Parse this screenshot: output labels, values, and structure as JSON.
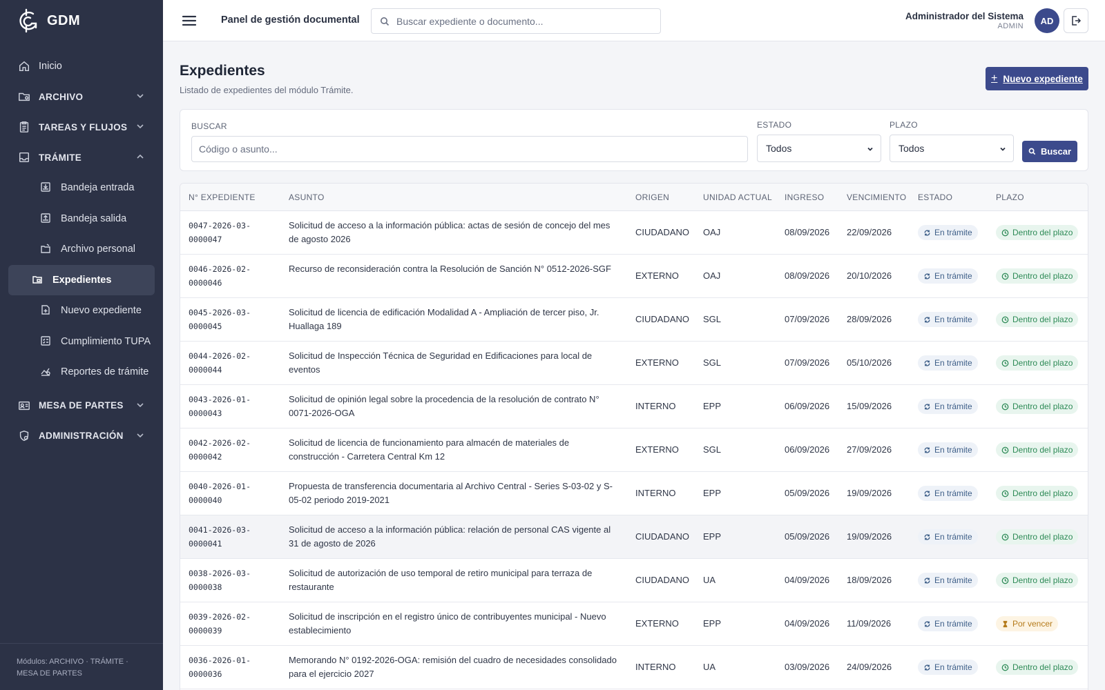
{
  "brand": {
    "name": "GDM"
  },
  "sidebar": {
    "items": [
      {
        "label": "Inicio",
        "icon": "home-icon",
        "type": "item"
      },
      {
        "label": "ARCHIVO",
        "icon": "folder-icon",
        "type": "section",
        "expanded": false
      },
      {
        "label": "TAREAS Y FLUJOS",
        "icon": "clipboard-icon",
        "type": "section",
        "expanded": false
      },
      {
        "label": "TRÁMITE",
        "icon": "inbox-icon",
        "type": "section",
        "expanded": true
      }
    ],
    "sub_items": [
      {
        "label": "Bandeja entrada",
        "icon": "inbox-in-icon"
      },
      {
        "label": "Bandeja salida",
        "icon": "inbox-out-icon"
      },
      {
        "label": "Archivo personal",
        "icon": "archive-icon"
      },
      {
        "label": "Expedientes",
        "icon": "folder-open-icon",
        "active": true
      },
      {
        "label": "Nuevo expediente",
        "icon": "file-plus-icon"
      },
      {
        "label": "Cumplimiento TUPA",
        "icon": "checklist-icon"
      },
      {
        "label": "Reportes de trámite",
        "icon": "chart-icon"
      }
    ],
    "bottom_sections": [
      {
        "label": "MESA DE PARTES",
        "icon": "id-card-icon"
      },
      {
        "label": "ADMINISTRACIÓN",
        "icon": "shield-gear-icon"
      }
    ],
    "footer": "Módulos: ARCHIVO · TRÁMITE · MESA DE PARTES"
  },
  "topbar": {
    "title": "Panel de gestión documental",
    "search_placeholder": "Buscar expediente o documento...",
    "user_name": "Administrador del Sistema",
    "user_role": "ADMIN",
    "avatar_initials": "AD"
  },
  "page": {
    "title": "Expedientes",
    "subtitle": "Listado de expedientes del módulo Trámite.",
    "new_button": "Nuevo expediente"
  },
  "filters": {
    "search_label": "BUSCAR",
    "search_placeholder": "Código o asunto...",
    "estado_label": "ESTADO",
    "estado_value": "Todos",
    "plazo_label": "PLAZO",
    "plazo_value": "Todos",
    "button": "Buscar"
  },
  "table": {
    "columns": [
      "N° EXPEDIENTE",
      "ASUNTO",
      "ORIGEN",
      "UNIDAD ACTUAL",
      "INGRESO",
      "VENCIMIENTO",
      "ESTADO",
      "PLAZO"
    ],
    "rows": [
      {
        "code": "0047-2026-03-0000047",
        "subject": "Solicitud de acceso a la información pública: actas de sesión de concejo del mes de agosto 2026",
        "origin": "CIUDADANO",
        "unit": "OAJ",
        "in": "08/09/2026",
        "due": "22/09/2026",
        "status": "En trámite",
        "term": "Dentro del plazo",
        "term_type": "ok"
      },
      {
        "code": "0046-2026-02-0000046",
        "subject": "Recurso de reconsideración contra la Resolución de Sanción N° 0512-2026-SGF",
        "origin": "EXTERNO",
        "unit": "OAJ",
        "in": "08/09/2026",
        "due": "20/10/2026",
        "status": "En trámite",
        "term": "Dentro del plazo",
        "term_type": "ok"
      },
      {
        "code": "0045-2026-03-0000045",
        "subject": "Solicitud de licencia de edificación Modalidad A - Ampliación de tercer piso, Jr. Huallaga 189",
        "origin": "CIUDADANO",
        "unit": "SGL",
        "in": "07/09/2026",
        "due": "28/09/2026",
        "status": "En trámite",
        "term": "Dentro del plazo",
        "term_type": "ok"
      },
      {
        "code": "0044-2026-02-0000044",
        "subject": "Solicitud de Inspección Técnica de Seguridad en Edificaciones para local de eventos",
        "origin": "EXTERNO",
        "unit": "SGL",
        "in": "07/09/2026",
        "due": "05/10/2026",
        "status": "En trámite",
        "term": "Dentro del plazo",
        "term_type": "ok"
      },
      {
        "code": "0043-2026-01-0000043",
        "subject": "Solicitud de opinión legal sobre la procedencia de la resolución de contrato N° 0071-2026-OGA",
        "origin": "INTERNO",
        "unit": "EPP",
        "in": "06/09/2026",
        "due": "15/09/2026",
        "status": "En trámite",
        "term": "Dentro del plazo",
        "term_type": "ok"
      },
      {
        "code": "0042-2026-02-0000042",
        "subject": "Solicitud de licencia de funcionamiento para almacén de materiales de construcción - Carretera Central Km 12",
        "origin": "EXTERNO",
        "unit": "SGL",
        "in": "06/09/2026",
        "due": "27/09/2026",
        "status": "En trámite",
        "term": "Dentro del plazo",
        "term_type": "ok"
      },
      {
        "code": "0040-2026-01-0000040",
        "subject": "Propuesta de transferencia documentaria al Archivo Central - Series S-03-02 y S-05-02 periodo 2019-2021",
        "origin": "INTERNO",
        "unit": "EPP",
        "in": "05/09/2026",
        "due": "19/09/2026",
        "status": "En trámite",
        "term": "Dentro del plazo",
        "term_type": "ok"
      },
      {
        "code": "0041-2026-03-0000041",
        "subject": "Solicitud de acceso a la información pública: relación de personal CAS vigente al 31 de agosto de 2026",
        "origin": "CIUDADANO",
        "unit": "EPP",
        "in": "05/09/2026",
        "due": "19/09/2026",
        "status": "En trámite",
        "term": "Dentro del plazo",
        "term_type": "ok",
        "hover": true
      },
      {
        "code": "0038-2026-03-0000038",
        "subject": "Solicitud de autorización de uso temporal de retiro municipal para terraza de restaurante",
        "origin": "CIUDADANO",
        "unit": "UA",
        "in": "04/09/2026",
        "due": "18/09/2026",
        "status": "En trámite",
        "term": "Dentro del plazo",
        "term_type": "ok"
      },
      {
        "code": "0039-2026-02-0000039",
        "subject": "Solicitud de inscripción en el registro único de contribuyentes municipal - Nuevo establecimiento",
        "origin": "EXTERNO",
        "unit": "EPP",
        "in": "04/09/2026",
        "due": "11/09/2026",
        "status": "En trámite",
        "term": "Por vencer",
        "term_type": "warn"
      },
      {
        "code": "0036-2026-01-0000036",
        "subject": "Memorando N° 0192-2026-OGA: remisión del cuadro de necesidades consolidado para el ejercicio 2027",
        "origin": "INTERNO",
        "unit": "UA",
        "in": "03/09/2026",
        "due": "24/09/2026",
        "status": "En trámite",
        "term": "Dentro del plazo",
        "term_type": "ok"
      }
    ]
  },
  "colors": {
    "sidebar": "#2c3246",
    "accent": "#3c4a8c",
    "ok": "#2d8a56",
    "warn": "#b57b1b",
    "tramite": "#3e5f88"
  }
}
